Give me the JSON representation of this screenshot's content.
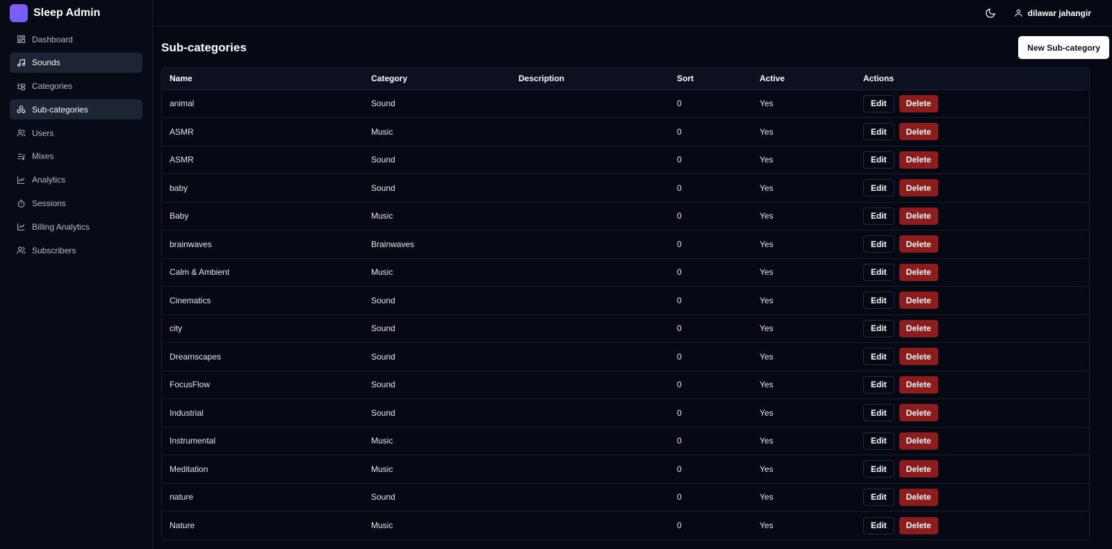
{
  "brand": {
    "title": "Sleep Admin",
    "logo_color": "#8b5cf6"
  },
  "sidebar": {
    "items": [
      {
        "label": "Dashboard",
        "icon": "grid-icon",
        "active": false
      },
      {
        "label": "Sounds",
        "icon": "music-note-icon",
        "active": true
      },
      {
        "label": "Categories",
        "icon": "folder-tree-icon",
        "active": false
      },
      {
        "label": "Sub-categories",
        "icon": "shapes-icon",
        "active": true
      },
      {
        "label": "Users",
        "icon": "users-icon",
        "active": false
      },
      {
        "label": "Mixes",
        "icon": "list-music-icon",
        "active": false
      },
      {
        "label": "Analytics",
        "icon": "line-chart-icon",
        "active": false
      },
      {
        "label": "Sessions",
        "icon": "timer-icon",
        "active": false
      },
      {
        "label": "Billing Analytics",
        "icon": "line-chart-icon",
        "active": false
      },
      {
        "label": "Subscribers",
        "icon": "users-icon",
        "active": false
      }
    ]
  },
  "topbar": {
    "user_name": "dilawar jahangir",
    "theme_icon": "moon-icon",
    "user_icon": "user-icon"
  },
  "page": {
    "title": "Sub-categories",
    "new_button_label": "New Sub-category"
  },
  "table": {
    "columns": [
      "Name",
      "Category",
      "Description",
      "Sort",
      "Active",
      "Actions"
    ],
    "edit_label": "Edit",
    "delete_label": "Delete",
    "rows": [
      {
        "name": "animal",
        "category": "Sound",
        "description": "",
        "sort": "0",
        "active": "Yes"
      },
      {
        "name": "ASMR",
        "category": "Music",
        "description": "",
        "sort": "0",
        "active": "Yes"
      },
      {
        "name": "ASMR",
        "category": "Sound",
        "description": "",
        "sort": "0",
        "active": "Yes"
      },
      {
        "name": "baby",
        "category": "Sound",
        "description": "",
        "sort": "0",
        "active": "Yes"
      },
      {
        "name": "Baby",
        "category": "Music",
        "description": "",
        "sort": "0",
        "active": "Yes"
      },
      {
        "name": "brainwaves",
        "category": "Brainwaves",
        "description": "",
        "sort": "0",
        "active": "Yes"
      },
      {
        "name": "Calm & Ambient",
        "category": "Music",
        "description": "",
        "sort": "0",
        "active": "Yes"
      },
      {
        "name": "Cinematics",
        "category": "Sound",
        "description": "",
        "sort": "0",
        "active": "Yes"
      },
      {
        "name": "city",
        "category": "Sound",
        "description": "",
        "sort": "0",
        "active": "Yes"
      },
      {
        "name": "Dreamscapes",
        "category": "Sound",
        "description": "",
        "sort": "0",
        "active": "Yes"
      },
      {
        "name": "FocusFlow",
        "category": "Sound",
        "description": "",
        "sort": "0",
        "active": "Yes"
      },
      {
        "name": "Industrial",
        "category": "Sound",
        "description": "",
        "sort": "0",
        "active": "Yes"
      },
      {
        "name": "Instrumental",
        "category": "Music",
        "description": "",
        "sort": "0",
        "active": "Yes"
      },
      {
        "name": "Meditation",
        "category": "Music",
        "description": "",
        "sort": "0",
        "active": "Yes"
      },
      {
        "name": "nature",
        "category": "Sound",
        "description": "",
        "sort": "0",
        "active": "Yes"
      },
      {
        "name": "Nature",
        "category": "Music",
        "description": "",
        "sort": "0",
        "active": "Yes"
      }
    ]
  },
  "colors": {
    "background": "#060914",
    "active_nav": "#1d2433",
    "delete": "#8b1d1d",
    "border": "#1b2130"
  }
}
